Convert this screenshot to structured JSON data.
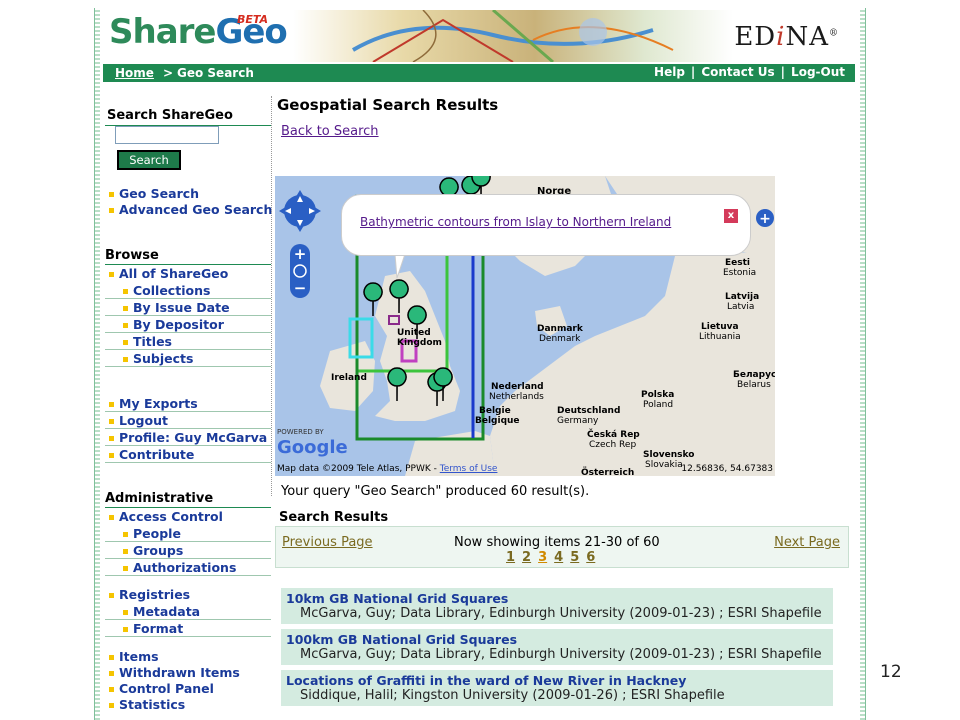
{
  "header": {
    "logo_share": "Share",
    "logo_geo": "Geo",
    "logo_beta": "BETA",
    "edina_prefix": "ED",
    "edina_i": "i",
    "edina_suffix": "NA",
    "edina_mark": "®"
  },
  "navbar": {
    "home": "Home",
    "separator": ">",
    "current": "Geo Search",
    "help": "Help",
    "contact": "Contact Us",
    "logout": "Log-Out",
    "divider": "|"
  },
  "sidebar": {
    "search_heading": "Search ShareGeo",
    "search_button": "Search",
    "search_links": [
      "Geo Search",
      "Advanced Geo Search"
    ],
    "browse_heading": "Browse",
    "browse_top": "All of ShareGeo",
    "browse_items": [
      "Collections",
      "By Issue Date",
      "By Depositor",
      "Titles",
      "Subjects"
    ],
    "account_items": [
      "My Exports",
      "Logout",
      "Profile: Guy McGarva",
      "Contribute"
    ],
    "admin_heading": "Administrative",
    "access_control": "Access Control",
    "access_items": [
      "People",
      "Groups",
      "Authorizations"
    ],
    "registries": "Registries",
    "registry_items": [
      "Metadata",
      "Format"
    ],
    "admin_items": [
      "Items",
      "Withdrawn Items",
      "Control Panel",
      "Statistics"
    ]
  },
  "main": {
    "title": "Geospatial Search Results",
    "back_link": "Back to Search",
    "query_text": "Your query \"Geo Search\" produced 60 result(s).",
    "results_heading": "Search Results"
  },
  "map": {
    "popup_link": "Bathymetric contours from Islay to Northern Ireland",
    "popup_close": "x",
    "credits": "Map data ©2009 Tele Atlas, PPWK - ",
    "terms": "Terms of Use",
    "coords": "12.56836, 54.67383",
    "powered_by": "POWERED BY",
    "google": "Google",
    "labels": {
      "norge": "Norge",
      "eesti": "Eesti",
      "estonia": "Estonia",
      "latvija": "Latvija",
      "latvia": "Latvia",
      "lietuva": "Lietuva",
      "lithuania": "Lithuania",
      "danmark": "Danmark",
      "danmark2": "Denmark",
      "uk1": "United",
      "uk2": "Kingdom",
      "ireland": "Ireland",
      "nederland": "Nederland",
      "netherlands": "Netherlands",
      "belgie": "Belgie",
      "belgique": "Belgique",
      "deutschland": "Deutschland",
      "germany": "Germany",
      "polska": "Polska",
      "poland": "Poland",
      "belarus": "Беларус",
      "belarus2": "Belarus",
      "ceska": "Česká Rep",
      "czech": "Czech Rep",
      "slovensko": "Slovensko",
      "slovakia": "Slovakia",
      "osterreich": "Österreich"
    }
  },
  "pager": {
    "previous": "Previous Page",
    "next": "Next Page",
    "showing": "Now showing items 21-30 of 60",
    "pages": [
      "1",
      "2",
      "3",
      "4",
      "5",
      "6"
    ],
    "current_page": "3"
  },
  "results": [
    {
      "title": "10km GB National Grid Squares",
      "meta": "McGarva, Guy; Data Library, Edinburgh University (2009-01-23) ; ESRI Shapefile"
    },
    {
      "title": "100km GB National Grid Squares",
      "meta": "McGarva, Guy; Data Library, Edinburgh University (2009-01-23) ; ESRI Shapefile"
    },
    {
      "title": "Locations of Graffiti in the ward of New River in Hackney",
      "meta": "Siddique, Halil; Kingston University (2009-01-26) ; ESRI Shapefile"
    }
  ],
  "slide_number": "12",
  "colors": {
    "brand_green": "#1e8a52",
    "link_blue": "#1a3a9a",
    "result_bg": "#d4ebe0",
    "bullet_yellow": "#f5c400"
  }
}
